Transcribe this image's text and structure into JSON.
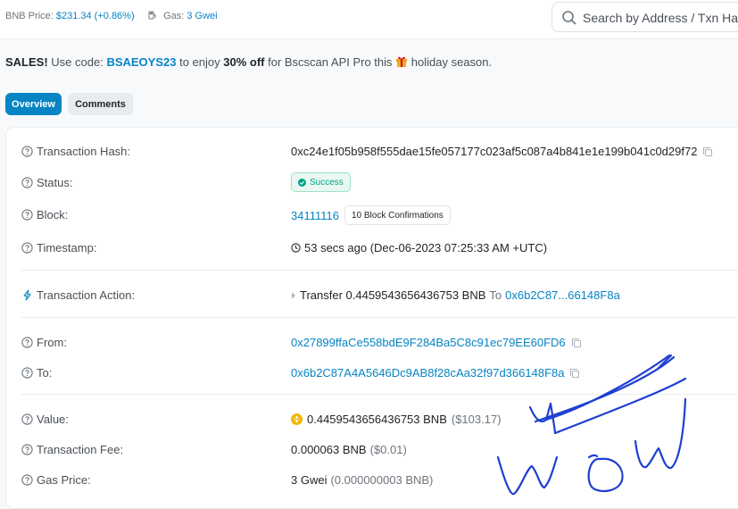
{
  "header": {
    "bnb_price_label": "BNB Price:",
    "bnb_price_value": "$231.34 (+0.86%)",
    "gas_label": "Gas:",
    "gas_value": "3 Gwei",
    "search_placeholder": "Search by Address / Txn Hash"
  },
  "banner": {
    "sales": "SALES!",
    "text1": " Use code: ",
    "code": "BSAEOYS23",
    "text2": " to enjoy ",
    "discount": "30% off",
    "text3": " for Bscscan API Pro this ",
    "text4": " holiday season."
  },
  "tabs": {
    "overview": "Overview",
    "comments": "Comments"
  },
  "details": {
    "tx_hash_label": "Transaction Hash:",
    "tx_hash": "0xc24e1f05b958f555dae15fe057177c023af5c087a4b841e1e199b041c0d29f72",
    "status_label": "Status:",
    "status": "Success",
    "block_label": "Block:",
    "block": "34111116",
    "confirmations": "10 Block Confirmations",
    "timestamp_label": "Timestamp:",
    "timestamp": "53 secs ago (Dec-06-2023 07:25:33 AM +UTC)",
    "action_label": "Transaction Action:",
    "action_verb": "Transfer 0.4459543656436753 BNB",
    "action_to": "To",
    "action_to_address": "0x6b2C87...66148F8a",
    "from_label": "From:",
    "from": "0x27899ffaCe558bdE9F284Ba5C8c91ec79EE60FD6",
    "to_label": "To:",
    "to": "0x6b2C87A4A5646Dc9AB8f28cAa32f97d366148F8a",
    "value_label": "Value:",
    "value": "0.4459543656436753 BNB",
    "value_usd": "($103.17)",
    "fee_label": "Transaction Fee:",
    "fee": "0.000063 BNB",
    "fee_usd": "($0.01)",
    "gas_price_label": "Gas Price:",
    "gas_price": "3 Gwei",
    "gas_price_bnb": "(0.000000003 BNB)"
  },
  "annotation": {
    "handwriting": "WOW",
    "ink_color": "#1f3fd1"
  },
  "colors": {
    "accent": "#0784c3",
    "success": "#00a186",
    "bnb": "#f0b90b"
  }
}
